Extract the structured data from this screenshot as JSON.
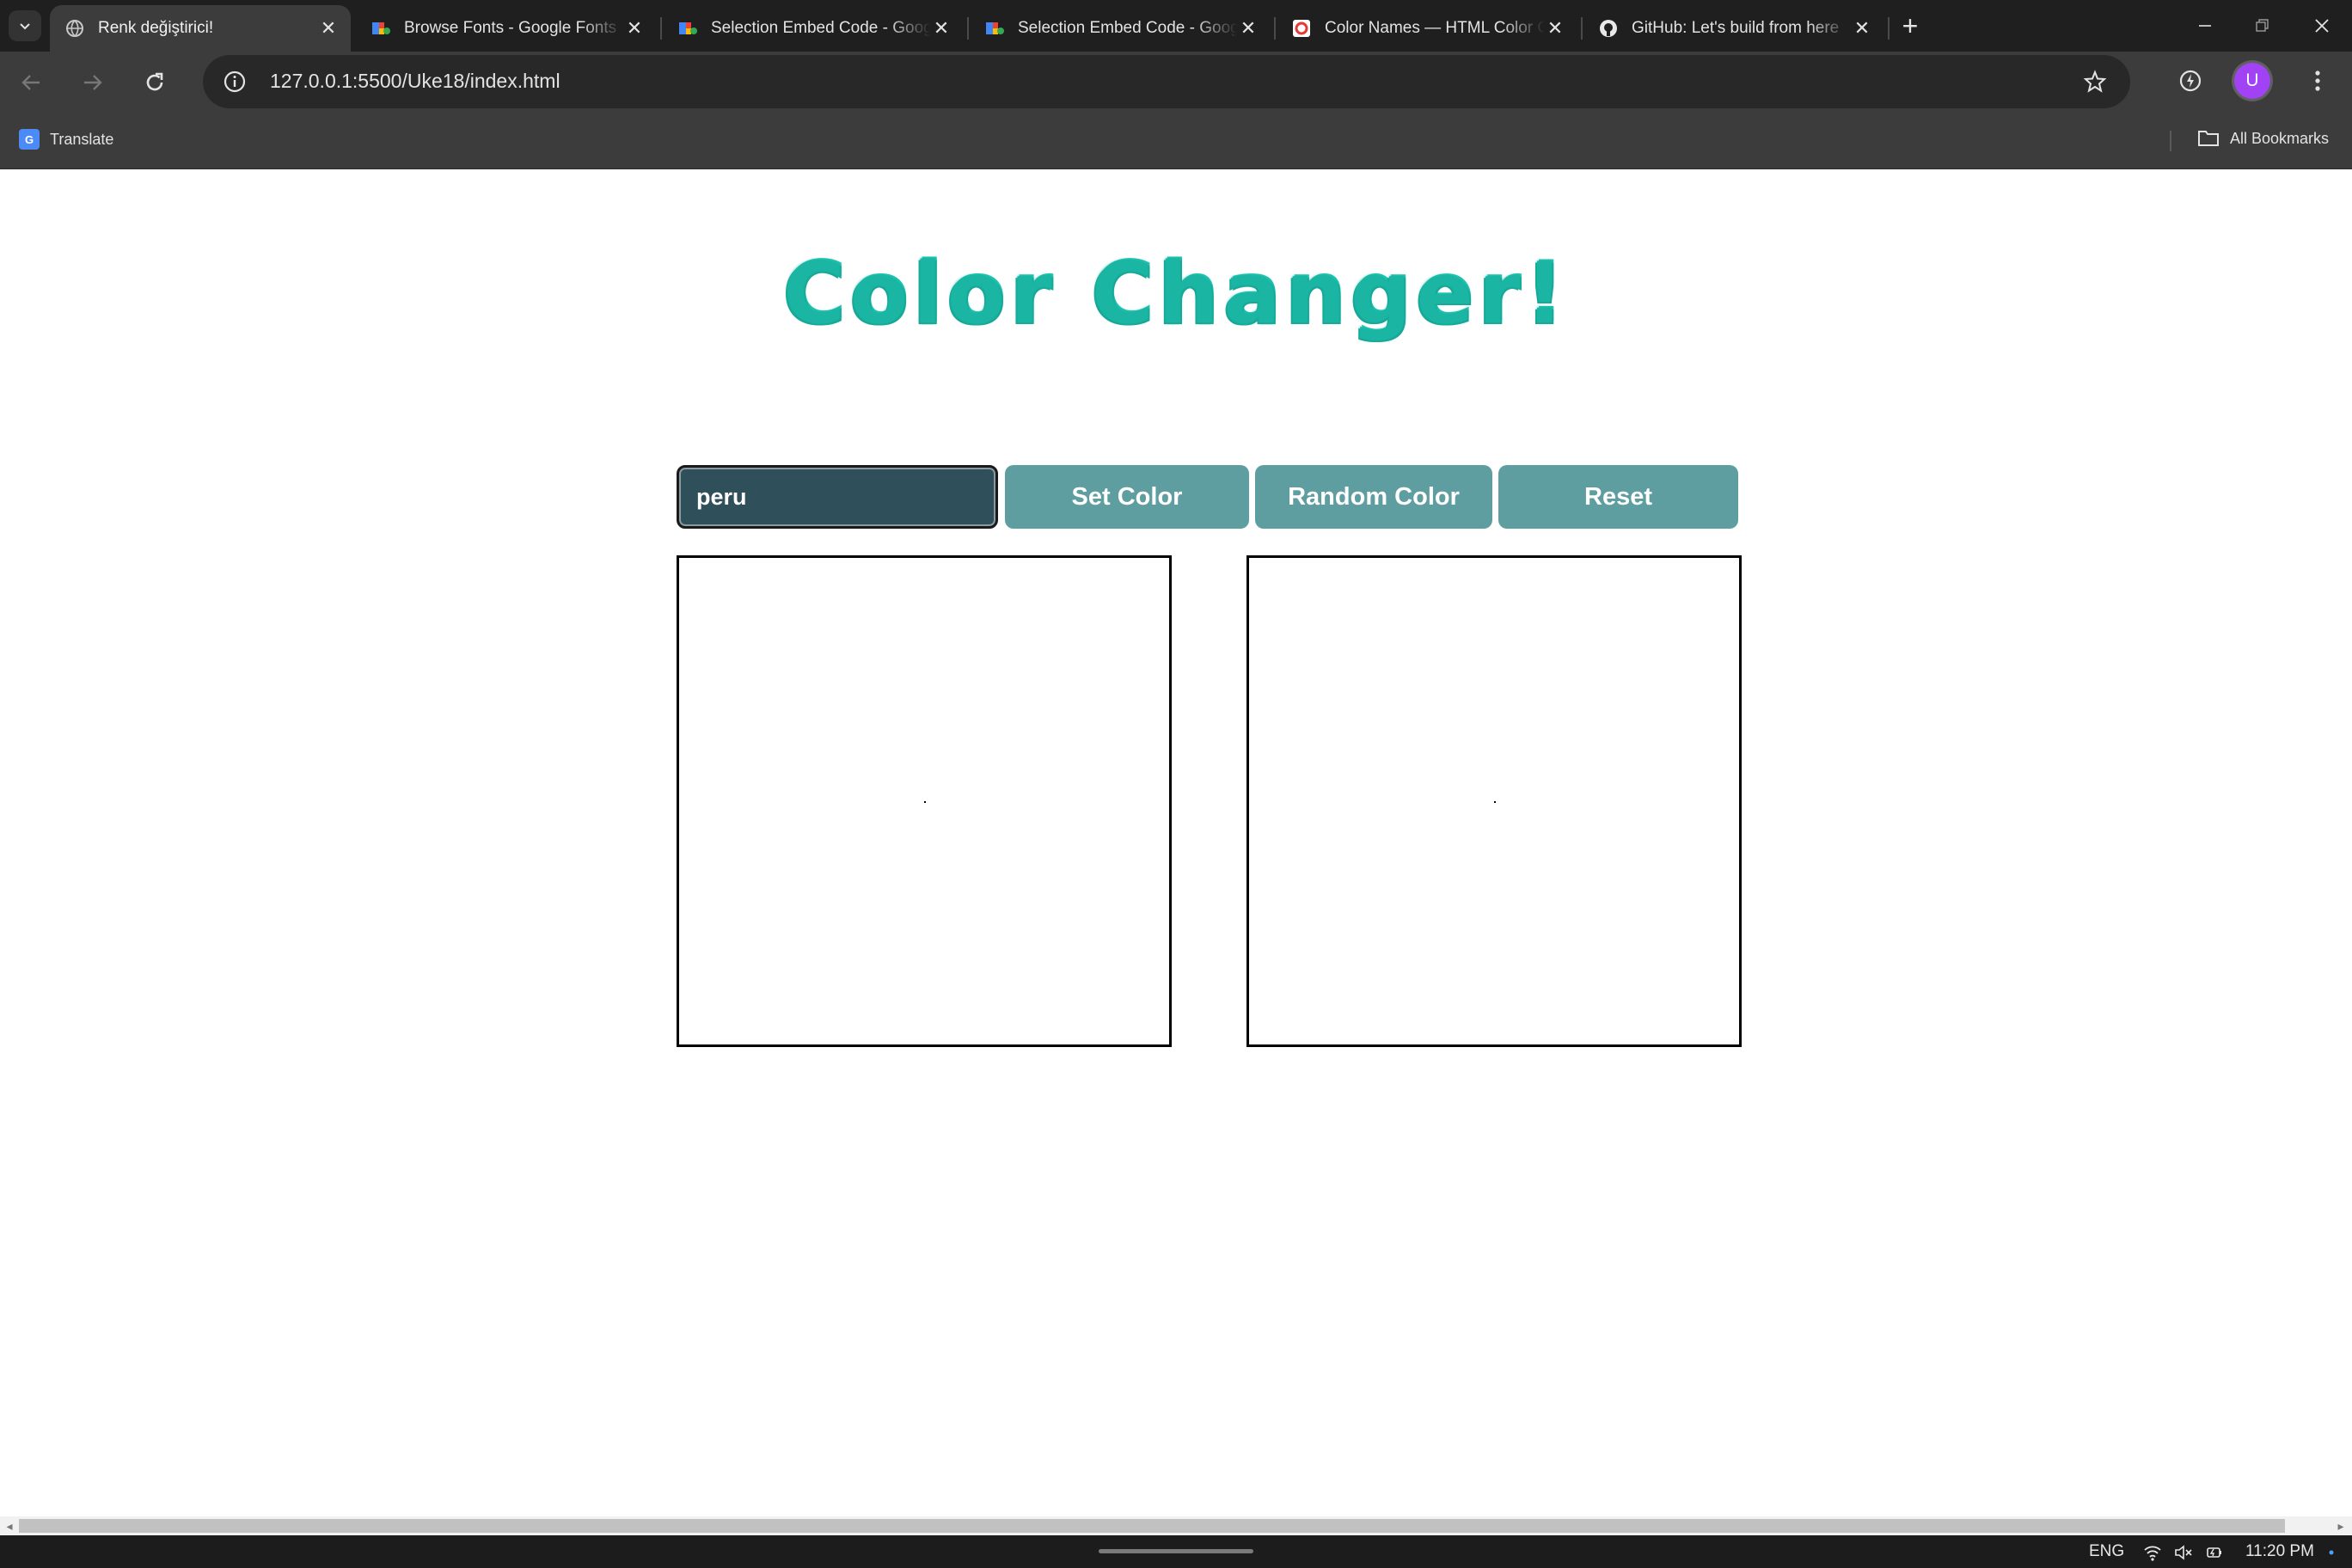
{
  "browser": {
    "tabs": [
      {
        "title": "Renk değiştirici!",
        "favicon": "globe-icon",
        "active": true
      },
      {
        "title": "Browse Fonts - Google Fonts",
        "favicon": "google-fonts-icon",
        "active": false
      },
      {
        "title": "Selection Embed Code - Google Fonts",
        "favicon": "google-fonts-icon",
        "active": false
      },
      {
        "title": "Selection Embed Code - Google Fonts",
        "favicon": "google-fonts-icon",
        "active": false
      },
      {
        "title": "Color Names — HTML Color Codes",
        "favicon": "htmlcolorcodes-icon",
        "active": false
      },
      {
        "title": "GitHub: Let's build from here",
        "favicon": "github-icon",
        "active": false
      }
    ],
    "url": "127.0.0.1:5500/Uke18/index.html",
    "profile_initial": "U",
    "bookmarks": {
      "translate_label": "Translate",
      "all_bookmarks_label": "All Bookmarks"
    }
  },
  "page": {
    "heading": "Color Changer!",
    "color_input_value": "peru",
    "buttons": {
      "set_color": "Set Color",
      "random_color": "Random Color",
      "reset": "Reset"
    },
    "colors": {
      "heading": "#1ab5a3",
      "input_bg": "#2f4f5a",
      "button_bg": "#5f9ea0"
    }
  },
  "taskbar": {
    "language": "ENG",
    "time": "11:20 PM"
  }
}
